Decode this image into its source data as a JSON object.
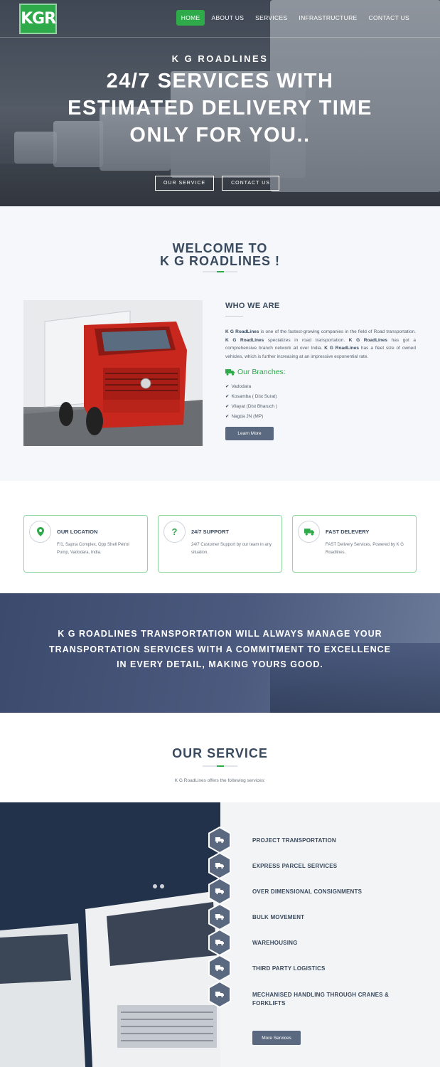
{
  "header": {
    "logo_text": "KGR",
    "nav": [
      "HOME",
      "ABOUT US",
      "SERVICES",
      "INFRASTRUCTURE",
      "CONTACT US"
    ]
  },
  "hero": {
    "subtitle": "K G ROADLINES",
    "title": "24/7 SERVICES WITH ESTIMATED DELIVERY TIME ONLY FOR YOU..",
    "btn_service": "OUR SERVICE",
    "btn_contact": "CONTACT US"
  },
  "welcome": {
    "title_line1": "WELCOME TO",
    "title_line2": "K G ROADLINES !",
    "who_title": "WHO WE ARE",
    "brand": "K G RoadLines",
    "text_1": " is one of the fastest-growing companies in the field of Road transportation. ",
    "text_2": " specializes in road transportation. ",
    "text_3": " has got a comprehensive branch network all over India. ",
    "text_4": " has a fleet size of owned vehicles, which is further increasing at an impressive exponential rate.",
    "branches_title": "Our Branches:",
    "branches": [
      "Vadodara",
      "Kosamba ( Dist Surat)",
      "Vilayat (Dist Bharuch )",
      "Nagda JN (MP)"
    ],
    "learn_more": "Learn More"
  },
  "cards": [
    {
      "icon": "map-pin-icon",
      "title": "OUR LOCATION",
      "desc": "F/1, Sapna Complex, Opp Shell Petrol Pump, Vadodara, India."
    },
    {
      "icon": "question-icon",
      "title": "24/7 SUPPORT",
      "desc": "24/7 Customer Support by our team in any situation."
    },
    {
      "icon": "truck-icon",
      "title": "FAST DELEVERY",
      "desc": "FAST Delivery Services, Powered by K G Roadlines."
    }
  ],
  "banner": {
    "text": "K G ROADLINES TRANSPORTATION WILL ALWAYS MANAGE YOUR TRANSPORTATION SERVICES WITH A COMMITMENT TO EXCELLENCE IN EVERY DETAIL, MAKING YOURS GOOD."
  },
  "services": {
    "title": "OUR SERVICE",
    "subtitle": "K G RoadLines offers the following services:",
    "items": [
      "PROJECT TRANSPORTATION",
      "EXPRESS PARCEL SERVICES",
      "OVER DIMENSIONAL CONSIGNMENTS",
      "BULK MOVEMENT",
      "WAREHOUSING",
      "THIRD PARTY LOGISTICS",
      "MECHANISED HANDLING THROUGH CRANES & FORKLIFTS"
    ],
    "more": "More Services"
  },
  "colors": {
    "accent": "#2eaa4a",
    "dark": "#3a4a5e",
    "button": "#5a6880",
    "hex": "#5a6880"
  }
}
